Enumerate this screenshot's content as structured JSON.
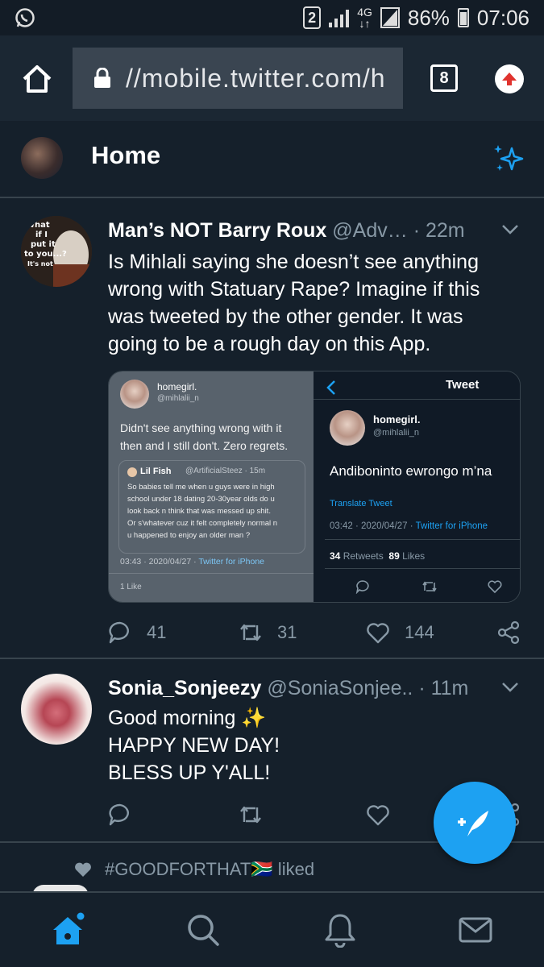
{
  "status_bar": {
    "sim": "2",
    "network": "4G",
    "battery": "86%",
    "time": "07:06"
  },
  "browser": {
    "url": "//mobile.twitter.com/h",
    "tab_count": "8"
  },
  "header": {
    "title": "Home"
  },
  "tweets": [
    {
      "name": "Man’s NOT Barry Roux ",
      "handle": "@Adv…",
      "time": "· 22m",
      "avatar_text": [
        "What",
        "if I",
        "put it",
        "to you...?",
        "It's not"
      ],
      "text": "Is Mihlali saying she doesn’t see anything wrong with Statuary Rape? Imagine if this was tweeted by the other gender. It was going to be a rough day on this App.",
      "media": {
        "left": {
          "name": "homegirl.",
          "handle": "@mihlalii_n",
          "text_line1": "Didn't see anything wrong with it",
          "text_line2": "then and I still don't. Zero regrets.",
          "quote_name": "Lil Fish",
          "quote_handle": "@ArtificialSteez · 15m",
          "quote_lines": [
            "So babies tell me when u guys were in high",
            "school under 18 dating 20-30year olds do u",
            "look back n think that was messed up shit.",
            "Or s'whatever cuz it felt completely normal n",
            "u happened to enjoy an older man ?"
          ],
          "timestamp": "03:43 · 2020/04/27 ·",
          "client": "Twitter for iPhone",
          "likes": "1 Like"
        },
        "right": {
          "title": "Tweet",
          "name": "homegirl.",
          "handle": "@mihlalii_n",
          "text": "Andiboninto ewrongo m’na",
          "translate": "Translate Tweet",
          "timestamp": "03:42 · 2020/04/27 ·",
          "client": "Twitter for iPhone",
          "retweets_count": "34",
          "retweets_label": "Retweets",
          "likes_count": "89",
          "likes_label": "Likes"
        }
      },
      "replies": "41",
      "retweets": "31",
      "likes": "144"
    },
    {
      "name": "Sonia_Sonjeezy",
      "handle": "@SoniaSonjee..",
      "time": "· 11m",
      "lines": [
        "Good morning ✨",
        "HAPPY NEW DAY!",
        "BLESS UP Y'ALL!"
      ]
    }
  ],
  "liked_notice": {
    "text": "#GOODFORTHAT🇿🇦 liked"
  },
  "colors": {
    "background": "#15202b",
    "accent": "#1da1f2",
    "muted": "#8899a6",
    "divider": "#38444d"
  },
  "icons": [
    "whatsapp-icon",
    "home-icon",
    "lock-icon",
    "tabs-icon",
    "upload-icon",
    "sparkle-icon",
    "chevron-down-icon",
    "reply-icon",
    "retweet-icon",
    "like-icon",
    "share-icon",
    "compose-icon",
    "search-icon",
    "bell-icon",
    "mail-icon",
    "heart-icon"
  ]
}
